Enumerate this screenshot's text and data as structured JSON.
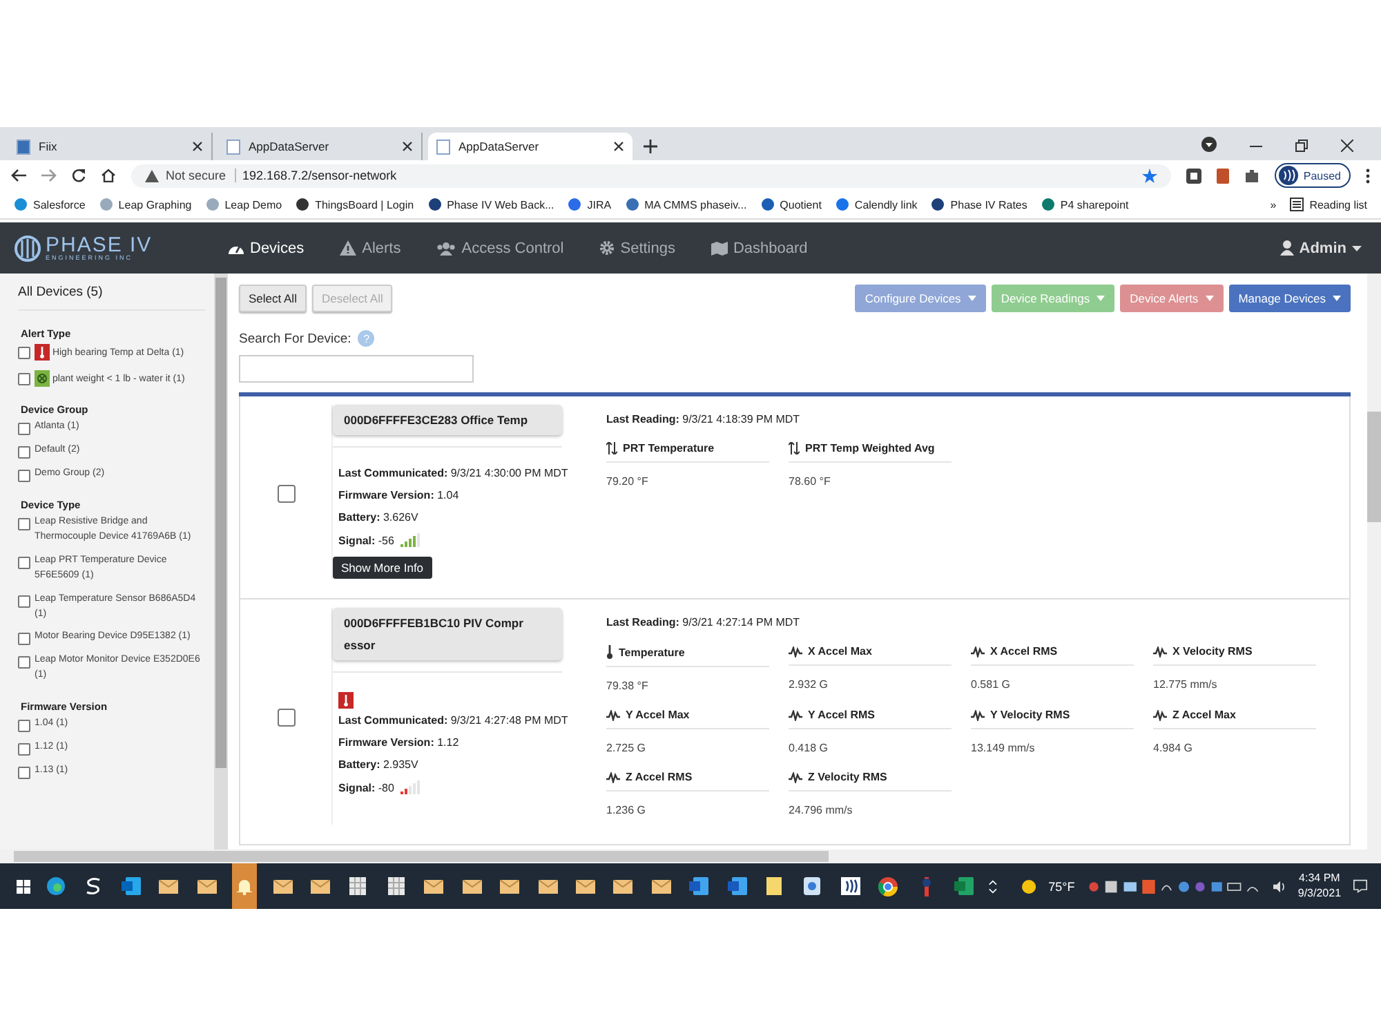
{
  "browser": {
    "tabs": [
      {
        "title": "Fiix",
        "selected": false
      },
      {
        "title": "AppDataServer",
        "selected": false
      },
      {
        "title": "AppDataServer",
        "selected": true
      }
    ],
    "security": "Not secure",
    "url": "192.168.7.2/sensor-network",
    "profile": "Paused",
    "bookmarks": [
      "Salesforce",
      "Leap Graphing",
      "Leap Demo",
      "ThingsBoard | Login",
      "Phase IV Web Back...",
      "JIRA",
      "MA CMMS phaseiv...",
      "Quotient",
      "Calendly link",
      "Phase IV Rates",
      "P4 sharepoint"
    ],
    "more": "»",
    "reading_list": "Reading list"
  },
  "app": {
    "logo": "PHASE IV",
    "logo_sub": "ENGINEERING INC",
    "nav": [
      {
        "label": "Devices",
        "kind": "gauge",
        "selected": true
      },
      {
        "label": "Alerts",
        "kind": "warning",
        "selected": false
      },
      {
        "label": "Access Control",
        "kind": "users",
        "selected": false
      },
      {
        "label": "Settings",
        "kind": "gear",
        "selected": false
      },
      {
        "label": "Dashboard",
        "kind": "map",
        "selected": false
      }
    ],
    "user": "Admin"
  },
  "sidebar": {
    "title": "All Devices (5)",
    "groups": [
      {
        "title": "Alert Type",
        "items": [
          {
            "label": "High bearing Temp at Delta (1)",
            "kind": "thermo",
            "checked": false
          },
          {
            "label": "plant weight < 1 lb - water it (1)",
            "kind": "weight",
            "checked": false
          }
        ]
      },
      {
        "title": "Device Group",
        "items": [
          {
            "label": "Atlanta (1)",
            "checked": false
          },
          {
            "label": "Default (2)",
            "checked": false
          },
          {
            "label": "Demo Group (2)",
            "checked": false
          }
        ]
      },
      {
        "title": "Device Type",
        "items": [
          {
            "label": "Leap Resistive Bridge and Thermocouple Device 41769A6B (1)",
            "checked": false
          },
          {
            "label": "Leap PRT Temperature Device 5F6E5609 (1)",
            "checked": false
          },
          {
            "label": "Leap Temperature Sensor B686A5D4 (1)",
            "checked": false
          },
          {
            "label": "Motor Bearing Device D95E1382 (1)",
            "checked": false
          },
          {
            "label": "Leap Motor Monitor Device E352D0E6 (1)",
            "checked": false
          }
        ]
      },
      {
        "title": "Firmware Version",
        "items": [
          {
            "label": "1.04 (1)",
            "checked": false
          },
          {
            "label": "1.12 (1)",
            "checked": false
          },
          {
            "label": "1.13 (1)",
            "checked": false
          }
        ]
      }
    ]
  },
  "toolbar": {
    "select_all": {
      "label": "Select All",
      "disabled": false
    },
    "deselect_all": {
      "label": "Deselect All",
      "disabled": true
    },
    "menus": [
      {
        "label": "Configure Devices",
        "color": "#8fa6d6"
      },
      {
        "label": "Device Readings",
        "color": "#8fcc8f"
      },
      {
        "label": "Device Alerts",
        "color": "#dc9092"
      },
      {
        "label": "Manage Devices",
        "color": "#4a72be"
      }
    ]
  },
  "search": {
    "label": "Search For Device:",
    "help": "?"
  },
  "devices": [
    {
      "name": "000D6FFFFE3CE283 Office Temp",
      "checked": false,
      "alert": false,
      "info": [
        {
          "label": "Last Communicated:",
          "value": "9/3/21 4:30:00 PM  MDT"
        },
        {
          "label": "Firmware Version:",
          "value": "1.04"
        },
        {
          "label": "Battery:",
          "value": "3.626V"
        },
        {
          "label": "Signal:",
          "value": "-56"
        }
      ],
      "signal": {
        "kind": "strong"
      },
      "more_button": "Show More Info",
      "last_reading_label": "Last Reading:",
      "last_reading": "9/3/21 4:18:39 PM  MDT",
      "readings": [
        {
          "label": "PRT Temperature",
          "kind": "updown",
          "value": "79.20 °F"
        },
        {
          "label": "PRT Temp Weighted Avg",
          "kind": "updown",
          "value": "78.60 °F"
        }
      ]
    },
    {
      "name": "000D6FFFFEB1BC10 PIV Compr essor",
      "checked": false,
      "alert": true,
      "info": [
        {
          "label": "Last Communicated:",
          "value": "9/3/21 4:27:48 PM  MDT"
        },
        {
          "label": "Firmware Version:",
          "value": "1.12"
        },
        {
          "label": "Battery:",
          "value": "2.935V"
        },
        {
          "label": "Signal:",
          "value": "-80"
        }
      ],
      "signal": {
        "kind": "weak"
      },
      "last_reading_label": "Last Reading:",
      "last_reading": "9/3/21 4:27:14 PM  MDT",
      "readings": [
        {
          "label": "Temperature",
          "kind": "thermo",
          "value": "79.38 °F"
        },
        {
          "label": "X Accel Max",
          "kind": "wave",
          "value": "2.932 G"
        },
        {
          "label": "X Accel RMS",
          "kind": "wave",
          "value": "0.581 G"
        },
        {
          "label": "X Velocity RMS",
          "kind": "wave",
          "value": "12.775 mm/s"
        },
        {
          "label": "Y Accel Max",
          "kind": "wave",
          "value": "2.725 G"
        },
        {
          "label": "Y Accel RMS",
          "kind": "wave",
          "value": "0.418 G"
        },
        {
          "label": "Y Velocity RMS",
          "kind": "wave",
          "value": "13.149 mm/s"
        },
        {
          "label": "Z Accel Max",
          "kind": "wave",
          "value": "4.984 G"
        },
        {
          "label": "Z Accel RMS",
          "kind": "wave",
          "value": "1.236 G"
        },
        {
          "label": "Z Velocity RMS",
          "kind": "wave",
          "value": "24.796 mm/s"
        }
      ]
    }
  ],
  "taskbar": {
    "temperature": "75°F",
    "time": "4:34 PM",
    "date": "9/3/2021"
  }
}
